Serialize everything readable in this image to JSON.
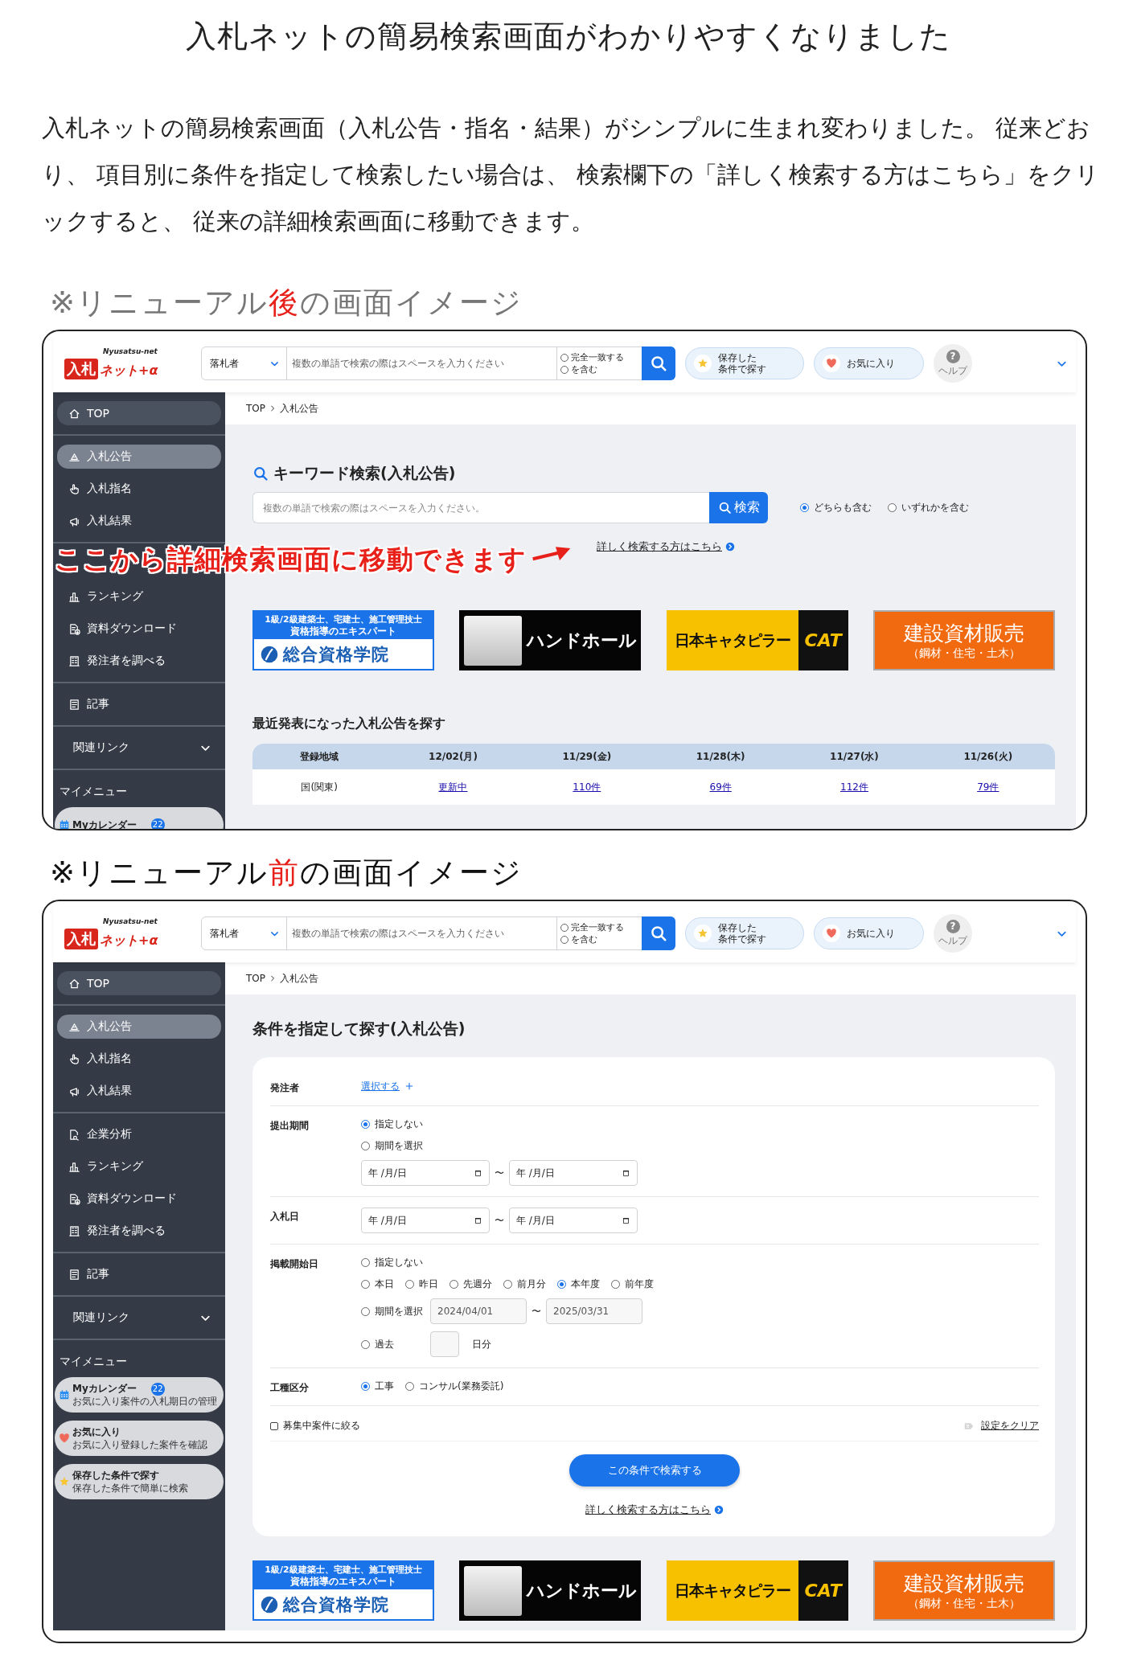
{
  "title": "入札ネットの簡易検索画面がわかりやすくなりました",
  "intro": "入札ネットの簡易検索画面（入札公告・指名・結果）がシンプルに生まれ変わりました。 従来どおり、 項目別に条件を指定して検索したい場合は、 検索欄下の「詳しく検索する方はこちら」をクリックすると、 従来の詳細検索画面に移動できます。",
  "sections": [
    {
      "heading": {
        "before": "※リニューアル",
        "highlight": "後",
        "after": "の画面イメージ",
        "faded": true
      },
      "screen": {
        "kind": "keyword",
        "header": {
          "logo": {
            "mark": "入札",
            "text": "ネット+α",
            "sub": "Nyusatsu-net"
          },
          "select": "落札者",
          "placeholder": "複数の単語で検索の際はスペースを入力ください",
          "match": [
            {
              "label": "完全一致する",
              "selected": false
            },
            {
              "label": "を含む",
              "selected": false
            }
          ],
          "saved": [
            "保存した",
            "条件で探す"
          ],
          "favorite": "お気に入り",
          "help": {
            "glyph": "?",
            "label": "ヘルプ"
          }
        },
        "sidebar": {
          "groups": [
            [
              {
                "kind": "home",
                "label": "TOP",
                "selected": false
              }
            ],
            [
              {
                "kind": "announce",
                "label": "入札公告",
                "selected": true
              },
              {
                "kind": "nominate",
                "label": "入札指名",
                "selected": false
              },
              {
                "kind": "result",
                "label": "入札結果",
                "selected": false
              }
            ],
            [
              {
                "kind": "ranking",
                "label": "ランキング",
                "selected": false
              },
              {
                "kind": "download",
                "label": "資料ダウンロード",
                "selected": false
              },
              {
                "kind": "orderer",
                "label": "発注者を調べる",
                "selected": false
              }
            ],
            [
              {
                "kind": "article",
                "label": "記事",
                "selected": false
              }
            ]
          ],
          "related": {
            "label": "関連リンク",
            "expanded": false
          },
          "mymenu_title": "マイメニュー",
          "mymenu": [
            {
              "kind": "calendar",
              "title": "Myカレンダー",
              "badge": "22"
            }
          ]
        },
        "breadcrumb": [
          "TOP",
          "入札公告"
        ],
        "keyword_search": {
          "title": "キーワード検索(入札公告)",
          "placeholder": "複数の単語で検索の際はスペースを入力ください。",
          "button": "検索",
          "options": [
            {
              "label": "どちらも含む",
              "selected": true
            },
            {
              "label": "いずれかを含む",
              "selected": false
            }
          ],
          "detail_link": "詳しく検索する方はこちら"
        },
        "banners": [
          {
            "kind": "school",
            "lines": [
              "1級/2級建築士、宅建士、施工管理技士",
              "資格指導のエキスパート",
              "総合資格学院"
            ]
          },
          {
            "kind": "handhole",
            "lines": [
              "ハンドホール"
            ]
          },
          {
            "kind": "cat",
            "lines": [
              "日本キャタピラー",
              "CAT"
            ]
          },
          {
            "kind": "materials",
            "lines": [
              "建設資材販売",
              "（鋼材・住宅・土木）"
            ]
          }
        ],
        "recent": {
          "title": "最近発表になった入札公告を探す",
          "columns": [
            "登録地域",
            "12/02(月)",
            "11/29(金)",
            "11/28(木)",
            "11/27(水)",
            "11/26(火)"
          ],
          "rows": [
            [
              "国(関東)",
              "更新中",
              "110件",
              "69件",
              "112件",
              "79件"
            ]
          ]
        },
        "annotation": "ここから詳細検索画面に移動できます"
      }
    },
    {
      "heading": {
        "before": "※リニューアル",
        "highlight": "前",
        "after": "の画面イメージ",
        "faded": false
      },
      "screen": {
        "kind": "conditions",
        "header": {
          "logo": {
            "mark": "入札",
            "text": "ネット+α",
            "sub": "Nyusatsu-net"
          },
          "select": "落札者",
          "placeholder": "複数の単語で検索の際はスペースを入力ください",
          "match": [
            {
              "label": "完全一致する",
              "selected": false
            },
            {
              "label": "を含む",
              "selected": false
            }
          ],
          "saved": [
            "保存した",
            "条件で探す"
          ],
          "favorite": "お気に入り",
          "help": {
            "glyph": "?",
            "label": "ヘルプ"
          }
        },
        "sidebar": {
          "groups": [
            [
              {
                "kind": "home",
                "label": "TOP",
                "selected": false
              }
            ],
            [
              {
                "kind": "announce",
                "label": "入札公告",
                "selected": true
              },
              {
                "kind": "nominate",
                "label": "入札指名",
                "selected": false
              },
              {
                "kind": "result",
                "label": "入札結果",
                "selected": false
              }
            ],
            [
              {
                "kind": "analysis",
                "label": "企業分析",
                "selected": false
              },
              {
                "kind": "ranking",
                "label": "ランキング",
                "selected": false
              },
              {
                "kind": "download",
                "label": "資料ダウンロード",
                "selected": false
              },
              {
                "kind": "orderer",
                "label": "発注者を調べる",
                "selected": false
              }
            ],
            [
              {
                "kind": "article",
                "label": "記事",
                "selected": false
              }
            ]
          ],
          "related": {
            "label": "関連リンク",
            "expanded": false
          },
          "mymenu_title": "マイメニュー",
          "mymenu": [
            {
              "kind": "calendar",
              "title": "Myカレンダー",
              "badge": "22",
              "desc": "お気に入り案件の入札期日の管理"
            },
            {
              "kind": "favorite",
              "title": "お気に入り",
              "desc": "お気に入り登録した案件を確認"
            },
            {
              "kind": "saved",
              "title": "保存した条件で探す",
              "desc": "保存した条件で簡単に検索"
            }
          ]
        },
        "breadcrumb": [
          "TOP",
          "入札公告"
        ],
        "conditions": {
          "title": "条件を指定して探す(入札公告)",
          "rows": [
            {
              "label": "発注者",
              "lines": [
                {
                  "kind": "select-link",
                  "text": "選択する"
                }
              ]
            },
            {
              "label": "提出期間",
              "lines": [
                {
                  "kind": "radios",
                  "options": [
                    {
                      "label": "指定しない",
                      "selected": true
                    }
                  ]
                },
                {
                  "kind": "radios",
                  "options": [
                    {
                      "label": "期間を選択",
                      "selected": false
                    }
                  ]
                },
                {
                  "kind": "date-range",
                  "from": "年 /月/日",
                  "sep": "〜",
                  "to": "年 /月/日"
                }
              ]
            },
            {
              "label": "入札日",
              "lines": [
                {
                  "kind": "date-range",
                  "from": "年 /月/日",
                  "sep": "〜",
                  "to": "年 /月/日"
                }
              ]
            },
            {
              "label": "掲載開始日",
              "lines": [
                {
                  "kind": "radios",
                  "options": [
                    {
                      "label": "指定しない",
                      "selected": false
                    }
                  ]
                },
                {
                  "kind": "radios",
                  "options": [
                    {
                      "label": "本日",
                      "selected": false
                    },
                    {
                      "label": "昨日",
                      "selected": false
                    },
                    {
                      "label": "先週分",
                      "selected": false
                    },
                    {
                      "label": "前月分",
                      "selected": false
                    },
                    {
                      "label": "本年度",
                      "selected": true
                    },
                    {
                      "label": "前年度",
                      "selected": false
                    }
                  ]
                },
                {
                  "kind": "radio-range",
                  "option": {
                    "label": "期間を選択",
                    "selected": false
                  },
                  "from": "2024/04/01",
                  "sep": "〜",
                  "to": "2025/03/31"
                },
                {
                  "kind": "radio-days",
                  "option": {
                    "label": "過去",
                    "selected": false
                  },
                  "suffix": "日分"
                }
              ]
            },
            {
              "label": "工種区分",
              "lines": [
                {
                  "kind": "radios",
                  "options": [
                    {
                      "label": "工事",
                      "selected": true
                    },
                    {
                      "label": "コンサル(業務委託)",
                      "selected": false
                    }
                  ]
                }
              ]
            }
          ],
          "filter": {
            "label": "募集中案件に絞る",
            "checked": false
          },
          "clear": "設定をクリア",
          "submit": "この条件で検索する",
          "detail_link": "詳しく検索する方はこちら"
        },
        "banners": [
          {
            "kind": "school",
            "lines": [
              "1級/2級建築士、宅建士、施工管理技士",
              "資格指導のエキスパート",
              "総合資格学院"
            ]
          },
          {
            "kind": "handhole",
            "lines": [
              "ハンドホール"
            ]
          },
          {
            "kind": "cat",
            "lines": [
              "日本キャタピラー",
              "CAT"
            ]
          },
          {
            "kind": "materials",
            "lines": [
              "建設資材販売",
              "（鋼材・住宅・土木）"
            ]
          }
        ]
      }
    }
  ]
}
